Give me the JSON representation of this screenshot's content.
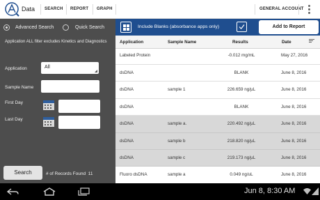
{
  "header": {
    "app_title": "Data",
    "menu": [
      "SEARCH",
      "REPORT",
      "GRAPH"
    ],
    "account": "GENERAL ACCOUNT"
  },
  "left_panel": {
    "mode_advanced": "Advanced Search",
    "mode_quick": "Quick Search",
    "selected_mode": "Advanced Search",
    "note": "Application ALL filter excludes Kinetics and Diagnostics",
    "application_label": "Application",
    "application_value": "All",
    "sample_name_label": "Sample Name",
    "sample_name_value": "",
    "first_day_label": "First Day",
    "first_day_value": "",
    "last_day_label": "Last Day",
    "last_day_value": "",
    "search_label": "Search",
    "records_label": "# of Records Found",
    "records_count": "11"
  },
  "toolbar": {
    "include_blanks_label": "Include Blanks (absorbance apps only)",
    "include_blanks_checked": true,
    "add_to_report_label": "Add to Report"
  },
  "table": {
    "columns": [
      "Application",
      "Sample Name",
      "Results",
      "Date"
    ],
    "rows": [
      {
        "application": "Labeled Protein",
        "sample": "",
        "result": "-0.012 mg/mL",
        "date": "May 27, 2016",
        "selected": false
      },
      {
        "application": "dsDNA",
        "sample": "",
        "result": "BLANK",
        "date": "June 8, 2016",
        "selected": false
      },
      {
        "application": "dsDNA",
        "sample": "sample 1",
        "result": "226.659 ng/µL",
        "date": "June 8, 2016",
        "selected": false
      },
      {
        "application": "dsDNA",
        "sample": "",
        "result": "BLANK",
        "date": "June 8, 2016",
        "selected": false
      },
      {
        "application": "dsDNA",
        "sample": "sample a.",
        "result": "220.492 ng/µL",
        "date": "June 8, 2016",
        "selected": true
      },
      {
        "application": "dsDNA",
        "sample": "sample b",
        "result": "218.820 ng/µL",
        "date": "June 8, 2016",
        "selected": true
      },
      {
        "application": "dsDNA",
        "sample": "sample c",
        "result": "219.173 ng/µL",
        "date": "June 8, 2016",
        "selected": true
      },
      {
        "application": "Fluoro dsDNA",
        "sample": "sample a",
        "result": "0.049 ng/uL",
        "date": "June 8, 2016",
        "selected": false
      }
    ]
  },
  "system_bar": {
    "clock": "Jun 8, 8:30 AM"
  },
  "colors": {
    "accent_blue": "#1f4e8f",
    "panel_gray": "#4d4d4d",
    "selected_row": "#d8d8d8"
  }
}
